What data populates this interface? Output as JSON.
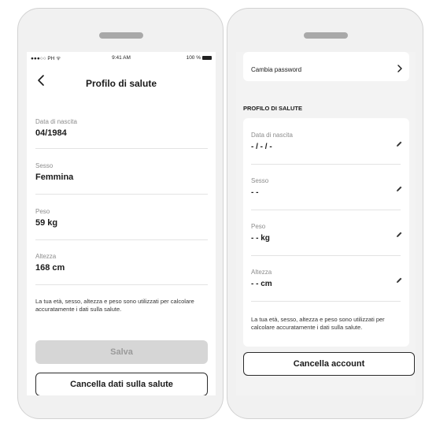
{
  "left": {
    "statusbar": {
      "carrier": "●●●○○ PH ᯤ",
      "time": "9:41 AM",
      "battery": "100 %"
    },
    "nav": {
      "title": "Profilo di salute"
    },
    "fields": [
      {
        "label": "Data di nascita",
        "value": "04/1984"
      },
      {
        "label": "Sesso",
        "value": "Femmina"
      },
      {
        "label": "Peso",
        "value": "59 kg"
      },
      {
        "label": "Altezza",
        "value": "168 cm"
      }
    ],
    "note": "La tua età, sesso, altezza e peso sono utilizzati per calcolare accuratamente i dati sulla salute.",
    "save_label": "Salva",
    "cancel_label": "Cancella dati sulla salute"
  },
  "right": {
    "password_label": "Cambia password",
    "section_title": "PROFILO DI SALUTE",
    "fields": [
      {
        "label": "Data di nascita",
        "value": "- / - / -"
      },
      {
        "label": "Sesso",
        "value": "- -"
      },
      {
        "label": "Peso",
        "value": "- - kg"
      },
      {
        "label": "Altezza",
        "value": "- - cm"
      }
    ],
    "note": "La tua età, sesso, altezza e peso sono utilizzati per calcolare accuratamente i dati sulla salute.",
    "cancel_account_label": "Cancella account"
  },
  "icons": {
    "back": "chevron-left-icon",
    "chevron": "chevron-right-icon",
    "edit": "pencil-icon",
    "battery": "battery-icon",
    "signal": "signal-icon",
    "wifi": "wifi-icon"
  },
  "colors": {
    "disabled_button": "#d6d6d6",
    "disabled_text": "#9a9a9a",
    "outline": "#2b2b2b",
    "label_gray": "#8c8c8c"
  }
}
